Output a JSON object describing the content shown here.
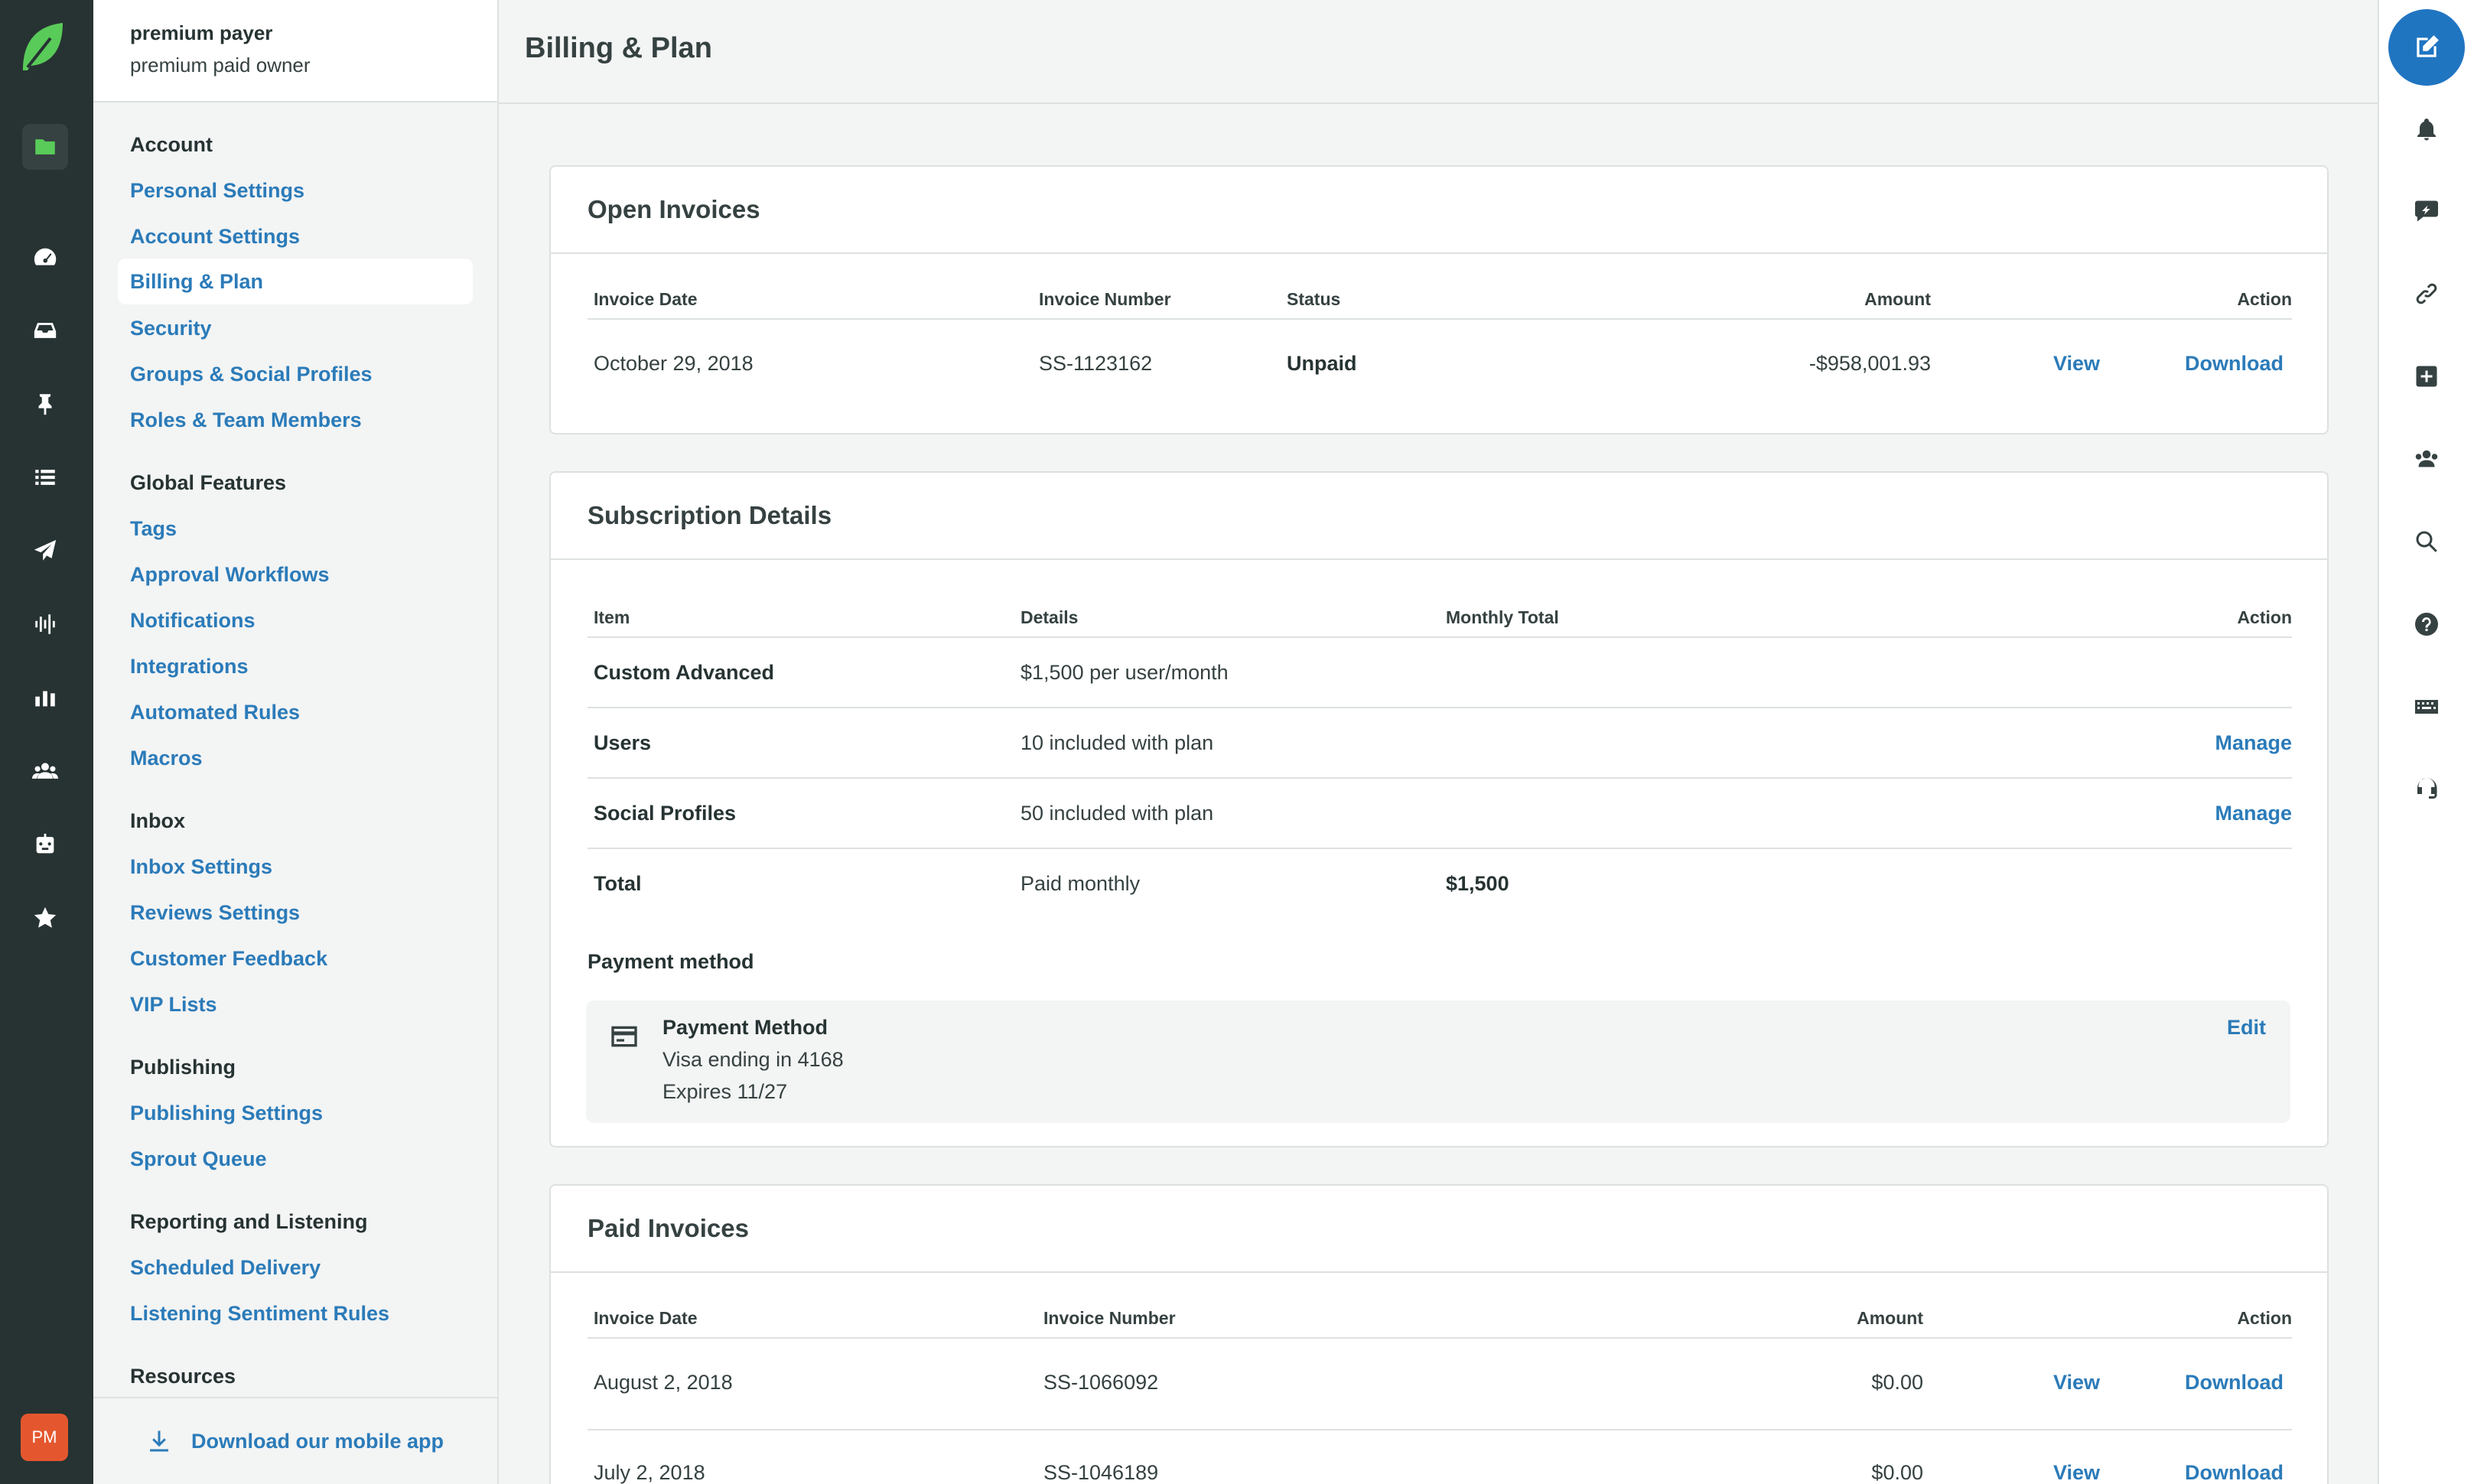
{
  "user": {
    "name": "premium payer",
    "role": "premium paid owner",
    "initials": "PM"
  },
  "page": {
    "title": "Billing & Plan"
  },
  "sidebar": {
    "sections": [
      {
        "heading": "Account",
        "items": [
          "Personal Settings",
          "Account Settings",
          "Billing & Plan",
          "Security",
          "Groups & Social Profiles",
          "Roles & Team Members"
        ]
      },
      {
        "heading": "Global Features",
        "items": [
          "Tags",
          "Approval Workflows",
          "Notifications",
          "Integrations",
          "Automated Rules",
          "Macros"
        ]
      },
      {
        "heading": "Inbox",
        "items": [
          "Inbox Settings",
          "Reviews Settings",
          "Customer Feedback",
          "VIP Lists"
        ]
      },
      {
        "heading": "Publishing",
        "items": [
          "Publishing Settings",
          "Sprout Queue"
        ]
      },
      {
        "heading": "Reporting and Listening",
        "items": [
          "Scheduled Delivery",
          "Listening Sentiment Rules"
        ]
      },
      {
        "heading": "Resources",
        "items": []
      }
    ],
    "active_item": "Billing & Plan",
    "footer_label": "Download our mobile app"
  },
  "open_invoices": {
    "title": "Open Invoices",
    "columns": [
      "Invoice Date",
      "Invoice Number",
      "Status",
      "Amount",
      "Action"
    ],
    "rows": [
      {
        "date": "October 29, 2018",
        "number": "SS-1123162",
        "status": "Unpaid",
        "amount": "-$958,001.93",
        "view": "View",
        "download": "Download"
      }
    ]
  },
  "subscription": {
    "title": "Subscription Details",
    "columns": [
      "Item",
      "Details",
      "Monthly Total",
      "Action"
    ],
    "rows": [
      {
        "item": "Custom Advanced",
        "details": "$1,500 per user/month",
        "total": "",
        "action": ""
      },
      {
        "item": "Users",
        "details": "10 included with plan",
        "total": "",
        "action": "Manage"
      },
      {
        "item": "Social Profiles",
        "details": "50 included with plan",
        "total": "",
        "action": "Manage"
      },
      {
        "item": "Total",
        "details": "Paid monthly",
        "total": "$1,500",
        "action": ""
      }
    ],
    "payment_heading": "Payment method",
    "payment": {
      "title": "Payment Method",
      "card": "Visa ending in 4168",
      "expires": "Expires 11/27",
      "edit": "Edit"
    }
  },
  "paid_invoices": {
    "title": "Paid Invoices",
    "columns": [
      "Invoice Date",
      "Invoice Number",
      "Amount",
      "Action"
    ],
    "rows": [
      {
        "date": "August 2, 2018",
        "number": "SS-1066092",
        "amount": "$0.00",
        "view": "View",
        "download": "Download"
      },
      {
        "date": "July 2, 2018",
        "number": "SS-1046189",
        "amount": "$0.00",
        "view": "View",
        "download": "Download"
      }
    ]
  },
  "colors": {
    "accent": "#2b7bb9",
    "nav_bg": "#273333",
    "logo_green": "#59cb59",
    "avatar": "#e4572e",
    "compose": "#2075c1"
  },
  "nav_icons": [
    "sprout-logo-icon",
    "folder-icon",
    "dashboard-icon",
    "inbox-icon",
    "pin-icon",
    "list-icon",
    "paper-plane-icon",
    "listening-icon",
    "reports-icon",
    "people-icon",
    "bot-icon",
    "star-icon"
  ],
  "rail_icons": [
    "compose-icon",
    "bell-icon",
    "chat-icon",
    "link-icon",
    "plus-square-icon",
    "users-icon",
    "search-icon",
    "help-icon",
    "keyboard-icon",
    "headset-icon"
  ]
}
